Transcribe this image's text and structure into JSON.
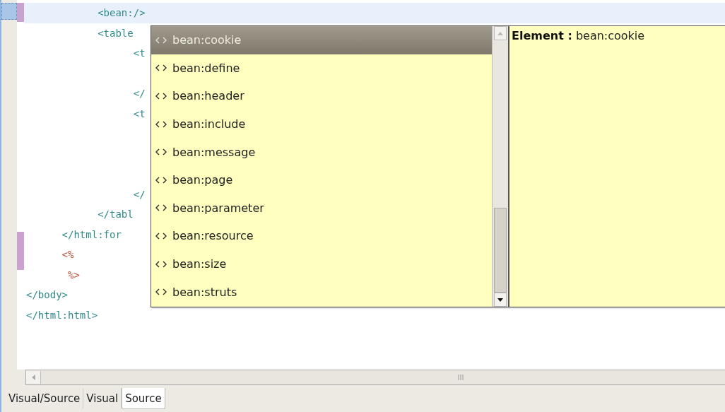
{
  "editor": {
    "lines": [
      {
        "text": "            <bean:/>",
        "kind": "tag",
        "current": true,
        "marked": true
      },
      {
        "text": "            <table",
        "kind": "tag",
        "current": false,
        "marked": false
      },
      {
        "text": "                  <t",
        "kind": "tag",
        "current": false,
        "marked": false
      },
      {
        "kind": "blank",
        "current": false,
        "marked": false
      },
      {
        "text": "                  </",
        "kind": "tag",
        "current": false,
        "marked": false
      },
      {
        "text": "                  <t",
        "kind": "tag",
        "current": false,
        "marked": false
      },
      {
        "kind": "blank",
        "current": false,
        "marked": false
      },
      {
        "kind": "blank",
        "current": false,
        "marked": false
      },
      {
        "kind": "blank",
        "current": false,
        "marked": false
      },
      {
        "text": "                  </",
        "kind": "tag",
        "current": false,
        "marked": false
      },
      {
        "text": "            </tabl",
        "kind": "tag",
        "current": false,
        "marked": false
      },
      {
        "text": "      </html:for",
        "kind": "tag",
        "current": false,
        "marked": false
      },
      {
        "text": "      <%",
        "kind": "jsp",
        "current": false,
        "marked": true
      },
      {
        "text": "       %>",
        "kind": "jsp",
        "current": false,
        "marked": true
      },
      {
        "text": "</body>",
        "kind": "tag",
        "current": false,
        "marked": false
      },
      {
        "text": "</html:html>",
        "kind": "tag",
        "current": false,
        "marked": false
      }
    ]
  },
  "completion": {
    "items": [
      {
        "label": "bean:cookie",
        "selected": true
      },
      {
        "label": "bean:define",
        "selected": false
      },
      {
        "label": "bean:header",
        "selected": false
      },
      {
        "label": "bean:include",
        "selected": false
      },
      {
        "label": "bean:message",
        "selected": false
      },
      {
        "label": "bean:page",
        "selected": false
      },
      {
        "label": "bean:parameter",
        "selected": false
      },
      {
        "label": "bean:resource",
        "selected": false
      },
      {
        "label": "bean:size",
        "selected": false
      },
      {
        "label": "bean:struts",
        "selected": false
      }
    ],
    "info": {
      "label": "Element :",
      "value": "bean:cookie"
    }
  },
  "tabs": [
    {
      "label": "Visual/Source",
      "selected": false
    },
    {
      "label": "Visual",
      "selected": false
    },
    {
      "label": "Source",
      "selected": true
    }
  ]
}
